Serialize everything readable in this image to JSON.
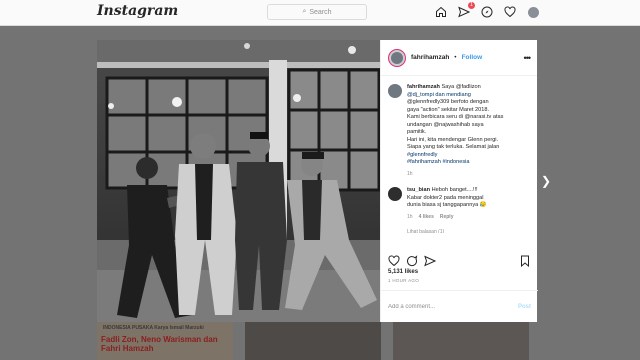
{
  "topbar": {
    "logo": "Instagram",
    "search_placeholder": "Search",
    "notification_count": "1"
  },
  "post": {
    "username": "fahrihamzah",
    "follow_label": "Follow",
    "separator": "•",
    "caption_username": "fahrihamzah",
    "caption_lines": [
      "Saya @fadlizon",
      "@dj_tompi dan mendiang",
      "@glennfredly309 berfoto dengan",
      "gaya \"action\" sekitar Maret 2018.",
      "Kami berbicara seru di @narasi.tv atas",
      "undangan @najwashihab saya",
      "pamitik.",
      "Hari ini, kita mendengar Glenn pergi.",
      "Siapa yang tak terluka. Selamat jalan",
      "#glennfredly",
      "#fahrihamzah #indonesia"
    ],
    "caption_time": "1h",
    "comment": {
      "username": "tsu_bian",
      "text_line1": "Heboh banget....!!!",
      "text_line2": "Kabar dokter2 pada meninggal",
      "text_line3": "dunia biasa sj tanggapannya 😥",
      "time": "1h",
      "likes": "4 likes",
      "reply": "Reply"
    },
    "more_comments_hint": "Lihat balasan (1)",
    "likes": "5,131 likes",
    "time": "1 HOUR AGO",
    "add_comment_placeholder": "Add a comment...",
    "post_button": "Post"
  },
  "background_tiles": [
    {
      "line1": "INDONESIA PUSAKA  Karya Ismail Marzuki",
      "line2": "Fadli Zon, Neno Warisman dan Fahri Hamzah"
    },
    {
      "line1": "",
      "line2": ""
    },
    {
      "line1": "",
      "line2": ""
    }
  ],
  "icons": {
    "home": "home-icon",
    "direct": "paper-plane-icon",
    "explore": "compass-icon",
    "activity": "heart-icon",
    "next": "chevron-right-icon"
  }
}
